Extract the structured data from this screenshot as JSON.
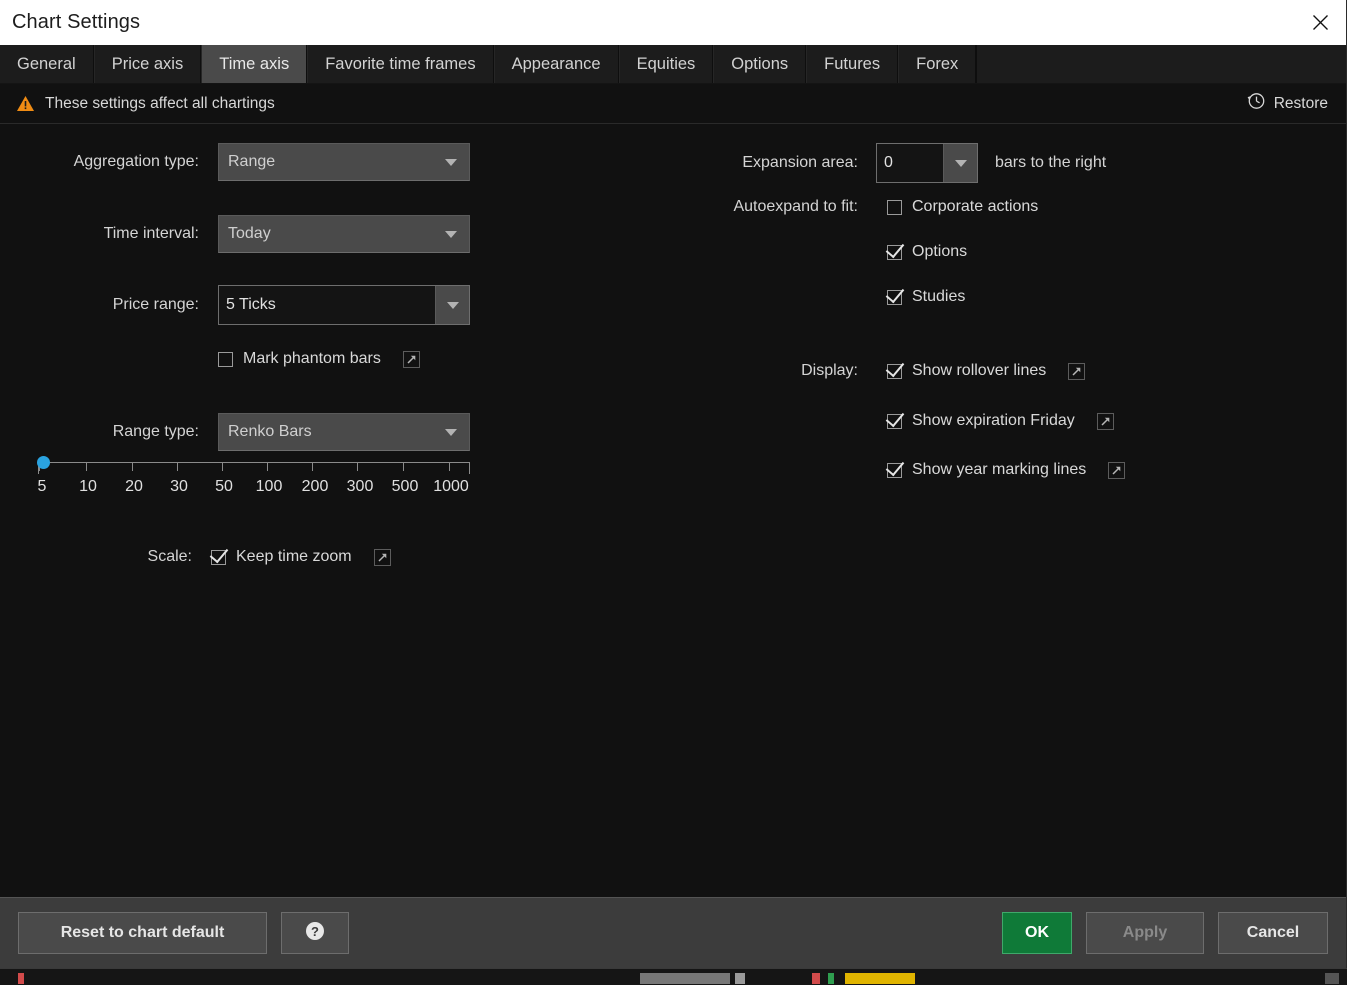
{
  "window": {
    "title": "Chart Settings",
    "close_icon": "close-icon"
  },
  "tabs": [
    {
      "label": "General",
      "active": false
    },
    {
      "label": "Price axis",
      "active": false
    },
    {
      "label": "Time axis",
      "active": true
    },
    {
      "label": "Favorite time frames",
      "active": false
    },
    {
      "label": "Appearance",
      "active": false
    },
    {
      "label": "Equities",
      "active": false
    },
    {
      "label": "Options",
      "active": false
    },
    {
      "label": "Futures",
      "active": false
    },
    {
      "label": "Forex",
      "active": false
    }
  ],
  "notice": {
    "icon": "warning-triangle-icon",
    "text": "These settings affect all chartings",
    "restore_label": "Restore",
    "restore_icon": "history-clock-icon",
    "warning_color": "#f08c14"
  },
  "left_column": {
    "aggregation_type": {
      "label": "Aggregation type:",
      "value": "Range"
    },
    "time_interval": {
      "label": "Time interval:",
      "value": "Today"
    },
    "price_range": {
      "label": "Price range:",
      "value": "5 Ticks"
    },
    "mark_phantom_bars": {
      "label": "Mark phantom bars",
      "checked": false,
      "link_icon": "external-link-icon"
    },
    "range_type": {
      "label": "Range type:",
      "value": "Renko Bars"
    },
    "slider": {
      "ticks": [
        "5",
        "10",
        "20",
        "30",
        "50",
        "100",
        "200",
        "300",
        "500",
        "1000"
      ],
      "value": "5",
      "thumb_color": "#2aa3e0"
    },
    "scale": {
      "label": "Scale:",
      "checkbox_label": "Keep time zoom",
      "checked": true,
      "link_icon": "external-link-icon"
    }
  },
  "right_column": {
    "expansion_area": {
      "label": "Expansion area:",
      "value": "0",
      "suffix": "bars to the right"
    },
    "autoexpand": {
      "label": "Autoexpand to fit:",
      "items": [
        {
          "label": "Corporate actions",
          "checked": false
        },
        {
          "label": "Options",
          "checked": true
        },
        {
          "label": "Studies",
          "checked": true
        }
      ]
    },
    "display": {
      "label": "Display:",
      "items": [
        {
          "label": "Show rollover lines",
          "checked": true,
          "link_icon": "external-link-icon"
        },
        {
          "label": "Show expiration Friday",
          "checked": true,
          "link_icon": "external-link-icon"
        },
        {
          "label": "Show year marking lines",
          "checked": true,
          "link_icon": "external-link-icon"
        }
      ]
    }
  },
  "footer": {
    "reset_label": "Reset to chart default",
    "help_icon": "help-question-icon",
    "ok_label": "OK",
    "apply_label": "Apply",
    "cancel_label": "Cancel",
    "ok_color": "#0f7a38",
    "apply_disabled": true
  }
}
